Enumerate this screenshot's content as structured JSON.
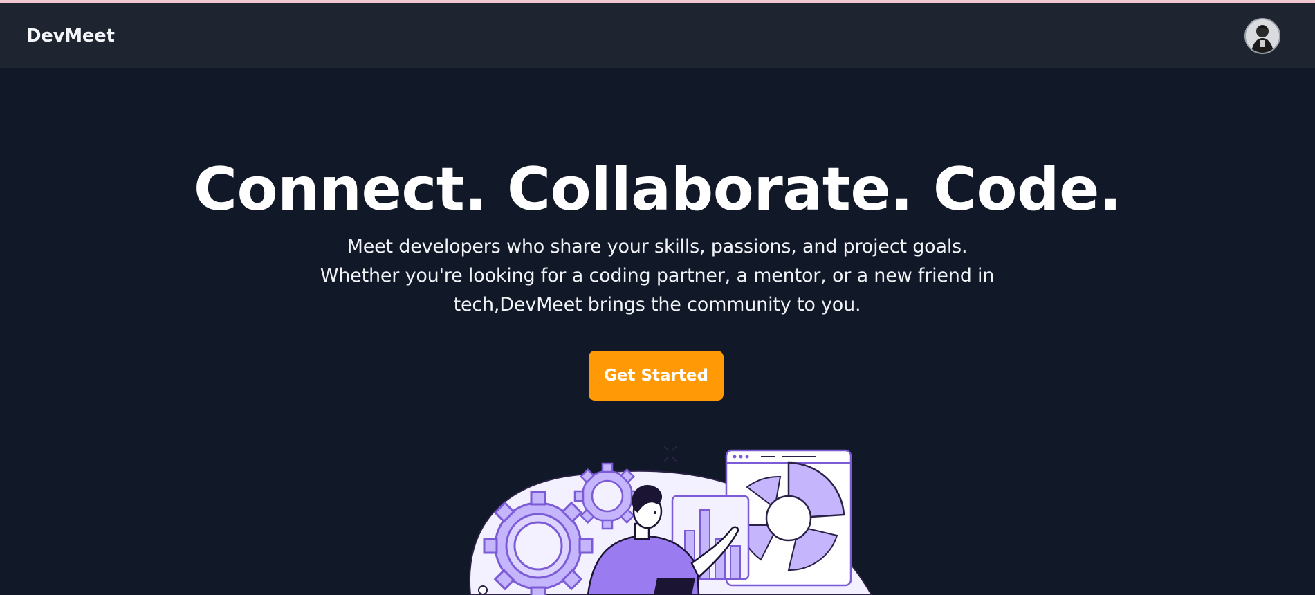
{
  "navbar": {
    "brand": "DevMeet",
    "avatar_icon": "user-avatar"
  },
  "hero": {
    "title": "Connect. Collaborate. Code.",
    "subtitle": "Meet developers who share your skills, passions, and project goals. Whether you're looking for a coding partner, a mentor, or a new friend in tech,DevMeet brings the community to you.",
    "cta_label": "Get Started"
  },
  "colors": {
    "page_bg": "#111827",
    "navbar_bg": "#1f2530",
    "accent": "#ff9a06",
    "illustration_purple": "#9b7bf0",
    "illustration_light": "#ede9fe"
  },
  "illustration": {
    "name": "developer-analytics-illustration"
  }
}
